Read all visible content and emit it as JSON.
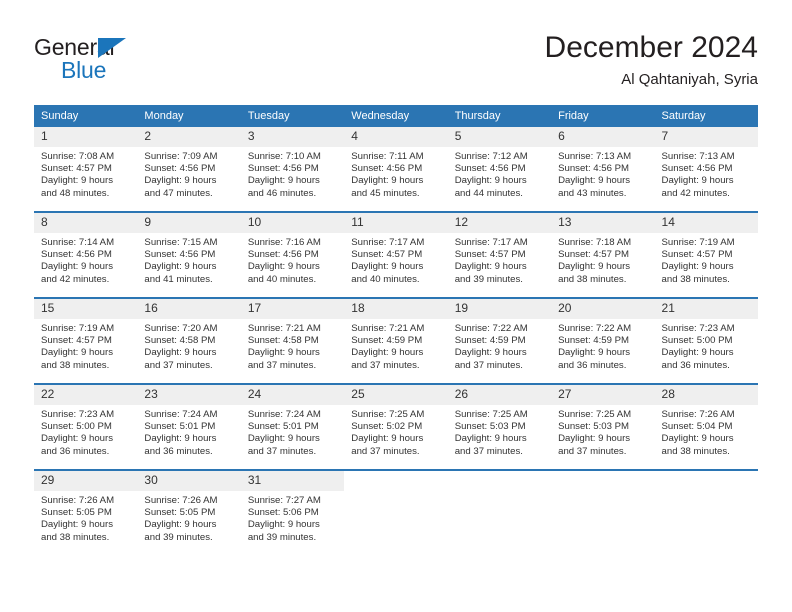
{
  "brand": {
    "name_top": "General",
    "name_bottom": "Blue",
    "accent_color": "#1b75bb"
  },
  "header": {
    "title": "December 2024",
    "subtitle": "Al Qahtaniyah, Syria"
  },
  "theme": {
    "header_bg": "#2b75b3",
    "daynum_bg": "#efefef",
    "text": "#333333"
  },
  "weekdays": [
    "Sunday",
    "Monday",
    "Tuesday",
    "Wednesday",
    "Thursday",
    "Friday",
    "Saturday"
  ],
  "weeks": [
    [
      {
        "day": "1",
        "text": "Sunrise: 7:08 AM\nSunset: 4:57 PM\nDaylight: 9 hours\nand 48 minutes."
      },
      {
        "day": "2",
        "text": "Sunrise: 7:09 AM\nSunset: 4:56 PM\nDaylight: 9 hours\nand 47 minutes."
      },
      {
        "day": "3",
        "text": "Sunrise: 7:10 AM\nSunset: 4:56 PM\nDaylight: 9 hours\nand 46 minutes."
      },
      {
        "day": "4",
        "text": "Sunrise: 7:11 AM\nSunset: 4:56 PM\nDaylight: 9 hours\nand 45 minutes."
      },
      {
        "day": "5",
        "text": "Sunrise: 7:12 AM\nSunset: 4:56 PM\nDaylight: 9 hours\nand 44 minutes."
      },
      {
        "day": "6",
        "text": "Sunrise: 7:13 AM\nSunset: 4:56 PM\nDaylight: 9 hours\nand 43 minutes."
      },
      {
        "day": "7",
        "text": "Sunrise: 7:13 AM\nSunset: 4:56 PM\nDaylight: 9 hours\nand 42 minutes."
      }
    ],
    [
      {
        "day": "8",
        "text": "Sunrise: 7:14 AM\nSunset: 4:56 PM\nDaylight: 9 hours\nand 42 minutes."
      },
      {
        "day": "9",
        "text": "Sunrise: 7:15 AM\nSunset: 4:56 PM\nDaylight: 9 hours\nand 41 minutes."
      },
      {
        "day": "10",
        "text": "Sunrise: 7:16 AM\nSunset: 4:56 PM\nDaylight: 9 hours\nand 40 minutes."
      },
      {
        "day": "11",
        "text": "Sunrise: 7:17 AM\nSunset: 4:57 PM\nDaylight: 9 hours\nand 40 minutes."
      },
      {
        "day": "12",
        "text": "Sunrise: 7:17 AM\nSunset: 4:57 PM\nDaylight: 9 hours\nand 39 minutes."
      },
      {
        "day": "13",
        "text": "Sunrise: 7:18 AM\nSunset: 4:57 PM\nDaylight: 9 hours\nand 38 minutes."
      },
      {
        "day": "14",
        "text": "Sunrise: 7:19 AM\nSunset: 4:57 PM\nDaylight: 9 hours\nand 38 minutes."
      }
    ],
    [
      {
        "day": "15",
        "text": "Sunrise: 7:19 AM\nSunset: 4:57 PM\nDaylight: 9 hours\nand 38 minutes."
      },
      {
        "day": "16",
        "text": "Sunrise: 7:20 AM\nSunset: 4:58 PM\nDaylight: 9 hours\nand 37 minutes."
      },
      {
        "day": "17",
        "text": "Sunrise: 7:21 AM\nSunset: 4:58 PM\nDaylight: 9 hours\nand 37 minutes."
      },
      {
        "day": "18",
        "text": "Sunrise: 7:21 AM\nSunset: 4:59 PM\nDaylight: 9 hours\nand 37 minutes."
      },
      {
        "day": "19",
        "text": "Sunrise: 7:22 AM\nSunset: 4:59 PM\nDaylight: 9 hours\nand 37 minutes."
      },
      {
        "day": "20",
        "text": "Sunrise: 7:22 AM\nSunset: 4:59 PM\nDaylight: 9 hours\nand 36 minutes."
      },
      {
        "day": "21",
        "text": "Sunrise: 7:23 AM\nSunset: 5:00 PM\nDaylight: 9 hours\nand 36 minutes."
      }
    ],
    [
      {
        "day": "22",
        "text": "Sunrise: 7:23 AM\nSunset: 5:00 PM\nDaylight: 9 hours\nand 36 minutes."
      },
      {
        "day": "23",
        "text": "Sunrise: 7:24 AM\nSunset: 5:01 PM\nDaylight: 9 hours\nand 36 minutes."
      },
      {
        "day": "24",
        "text": "Sunrise: 7:24 AM\nSunset: 5:01 PM\nDaylight: 9 hours\nand 37 minutes."
      },
      {
        "day": "25",
        "text": "Sunrise: 7:25 AM\nSunset: 5:02 PM\nDaylight: 9 hours\nand 37 minutes."
      },
      {
        "day": "26",
        "text": "Sunrise: 7:25 AM\nSunset: 5:03 PM\nDaylight: 9 hours\nand 37 minutes."
      },
      {
        "day": "27",
        "text": "Sunrise: 7:25 AM\nSunset: 5:03 PM\nDaylight: 9 hours\nand 37 minutes."
      },
      {
        "day": "28",
        "text": "Sunrise: 7:26 AM\nSunset: 5:04 PM\nDaylight: 9 hours\nand 38 minutes."
      }
    ],
    [
      {
        "day": "29",
        "text": "Sunrise: 7:26 AM\nSunset: 5:05 PM\nDaylight: 9 hours\nand 38 minutes."
      },
      {
        "day": "30",
        "text": "Sunrise: 7:26 AM\nSunset: 5:05 PM\nDaylight: 9 hours\nand 39 minutes."
      },
      {
        "day": "31",
        "text": "Sunrise: 7:27 AM\nSunset: 5:06 PM\nDaylight: 9 hours\nand 39 minutes."
      },
      {
        "day": "",
        "text": ""
      },
      {
        "day": "",
        "text": ""
      },
      {
        "day": "",
        "text": ""
      },
      {
        "day": "",
        "text": ""
      }
    ]
  ]
}
